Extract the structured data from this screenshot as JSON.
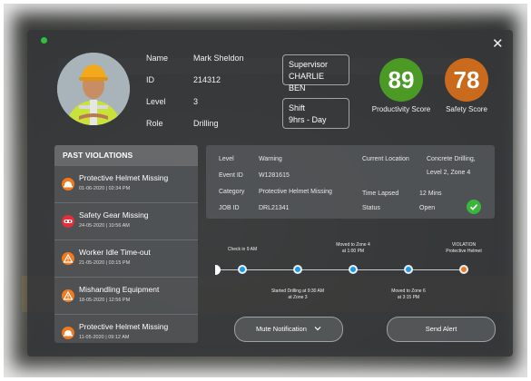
{
  "worker": {
    "fields": [
      {
        "label": "Name",
        "value": "Mark Sheldon"
      },
      {
        "label": "ID",
        "value": "214312"
      },
      {
        "label": "Level",
        "value": "3"
      },
      {
        "label": "Role",
        "value": "Drilling"
      }
    ],
    "supervisor_label": "Supervisor",
    "supervisor_value": "CHARLIE BEN",
    "shift_label": "Shift",
    "shift_value": "9hrs - Day"
  },
  "scores": {
    "productivity": {
      "value": "89",
      "label": "Productivity Score",
      "color": "#4a9a25"
    },
    "safety": {
      "value": "78",
      "label": "Safety Score",
      "color": "#c96a1d"
    }
  },
  "violations": {
    "title": "PAST VIOLATIONS",
    "items": [
      {
        "title": "Protective Helmet Missing",
        "date": "01-06-2020 | 02:34 PM",
        "icon": "helmet-icon",
        "color": "#f07a1d"
      },
      {
        "title": "Safety Gear Missing",
        "date": "24-05-2020 | 10:56 AM",
        "icon": "goggles-icon",
        "color": "#e0303b"
      },
      {
        "title": "Worker Idle Time-out",
        "date": "21-05-2020 | 03:15 PM",
        "icon": "warning-icon",
        "color": "#f07a1d"
      },
      {
        "title": "Mishandling Equipment",
        "date": "18-05-2020 | 12:56 PM",
        "icon": "warning-icon",
        "color": "#f07a1d"
      },
      {
        "title": "Protective Helmet Missing",
        "date": "11-05-2020 | 09:12 AM",
        "icon": "helmet-icon",
        "color": "#f07a1d"
      }
    ]
  },
  "incident": {
    "level_label": "Level",
    "level_value": "Warning",
    "event_label": "Event ID",
    "event_value": "W1281615",
    "category_label": "Category",
    "category_value": "Protective Helmet Missing",
    "job_label": "JOB ID",
    "job_value": "DRL21341",
    "location_label": "Current Location",
    "location_value_1": "Concrete Drilling,",
    "location_value_2": "Level 2,   Zone 4",
    "lapsed_label": "Time Lapsed",
    "lapsed_value": "12 Mins",
    "status_label": "Status",
    "status_value": "Open",
    "status_icon": "check-icon"
  },
  "timeline": {
    "top_labels": [
      {
        "line1": "Check in 9 AM",
        "line2": ""
      },
      {
        "line1": "Moved to Zone 4",
        "line2": "at 1:00 PM"
      },
      {
        "line1": "VIOLATION",
        "line2": "Protective Helmet"
      }
    ],
    "bottom_labels": [
      {
        "line1": "Started Drilling at 9:30 AM",
        "line2": "at Zone 3"
      },
      {
        "line1": "Moved to Zone 6",
        "line2": "at 3:15 PM"
      }
    ]
  },
  "actions": {
    "mute_label": "Mute Notification",
    "alert_label": "Send Alert"
  }
}
